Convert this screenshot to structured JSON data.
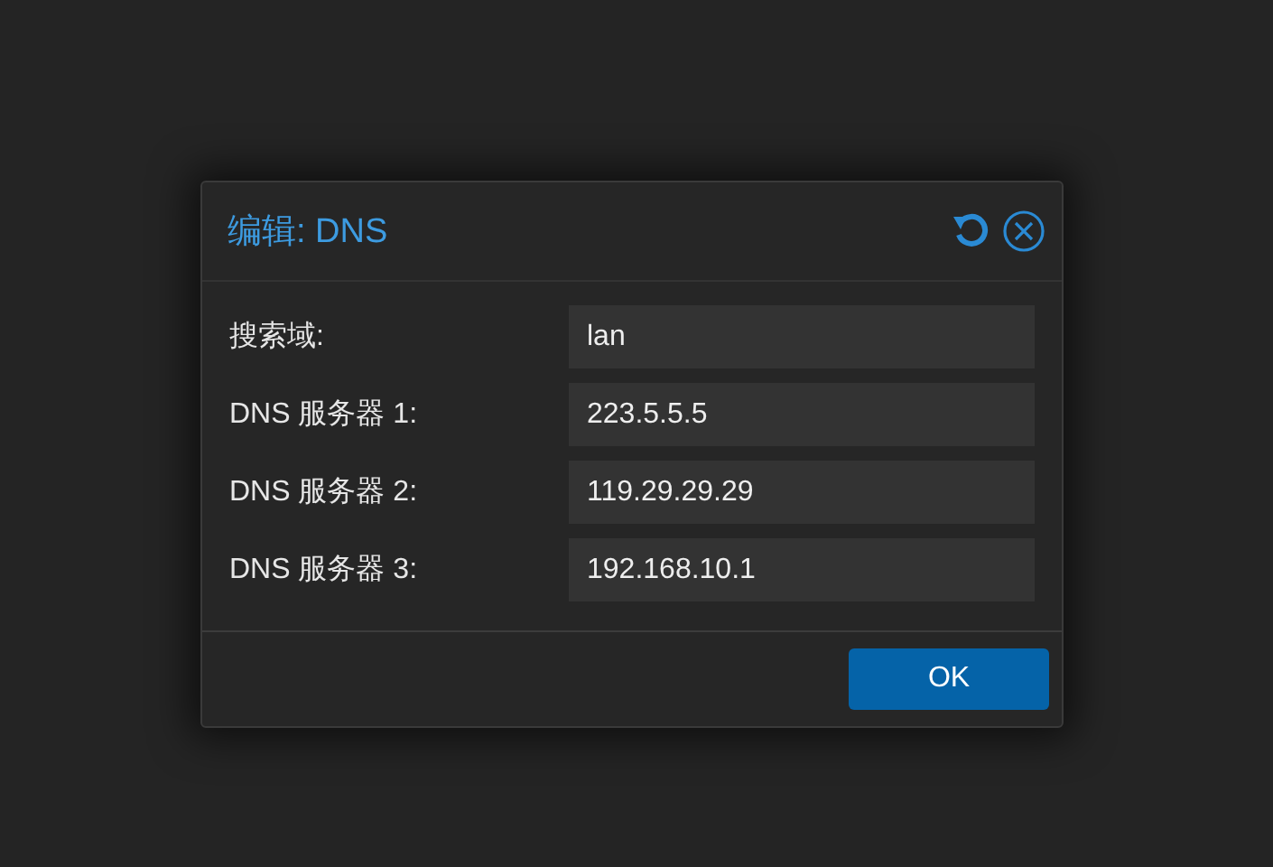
{
  "dialog": {
    "title": "编辑: DNS",
    "fields": [
      {
        "label": "搜索域:",
        "value": "lan"
      },
      {
        "label": "DNS 服务器 1:",
        "value": "223.5.5.5"
      },
      {
        "label": "DNS 服务器 2:",
        "value": "119.29.29.29"
      },
      {
        "label": "DNS 服务器 3:",
        "value": "192.168.10.1"
      }
    ],
    "buttons": [
      "OK"
    ]
  }
}
